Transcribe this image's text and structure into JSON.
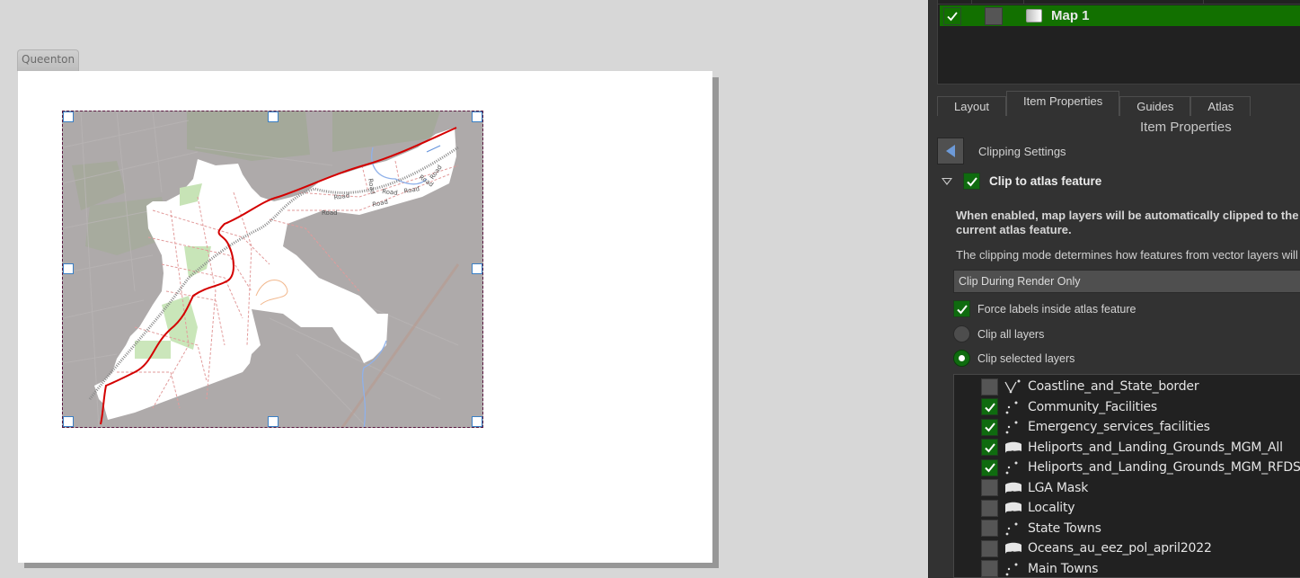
{
  "canvas": {
    "atlas_tab": "Queenton",
    "map_labels": [
      "Road",
      "Road",
      "Road",
      "Road",
      "Road",
      "Road",
      "Road",
      "Road"
    ]
  },
  "items_tree": {
    "rows": [
      {
        "visible": true,
        "locked": false,
        "name": "Map 1",
        "selected": true
      }
    ]
  },
  "tabs": [
    {
      "label": "Layout",
      "active": false
    },
    {
      "label": "Item Properties",
      "active": true
    },
    {
      "label": "Guides",
      "active": false
    },
    {
      "label": "Atlas",
      "active": false
    }
  ],
  "panel_title": "Item Properties",
  "section": {
    "back_label": "Clipping Settings",
    "clip_to_atlas": {
      "label": "Clip to atlas feature",
      "checked": true
    },
    "description": "When enabled, map layers will be automatically clipped to the\ncurrent atlas feature.",
    "mode_description": "The clipping mode determines how features from vector layers will be",
    "mode_select": {
      "value": "Clip During Render Only"
    },
    "force_labels": {
      "label": "Force labels inside atlas feature",
      "checked": true
    },
    "radio_options": [
      {
        "label": "Clip all layers",
        "selected": false
      },
      {
        "label": "Clip selected layers",
        "selected": true
      }
    ],
    "layers": [
      {
        "name": "Coastline_and_State_border",
        "checked": false,
        "type": "line"
      },
      {
        "name": "Community_Facilities",
        "checked": true,
        "type": "point"
      },
      {
        "name": "Emergency_services_facilities",
        "checked": true,
        "type": "point"
      },
      {
        "name": "Heliports_and_Landing_Grounds_MGM_All",
        "checked": true,
        "type": "polygon"
      },
      {
        "name": "Heliports_and_Landing_Grounds_MGM_RFDS_",
        "checked": true,
        "type": "point"
      },
      {
        "name": "LGA Mask",
        "checked": false,
        "type": "polygon"
      },
      {
        "name": "Locality",
        "checked": false,
        "type": "polygon"
      },
      {
        "name": "State Towns",
        "checked": false,
        "type": "point"
      },
      {
        "name": "Oceans_au_eez_pol_april2022",
        "checked": false,
        "type": "polygon"
      },
      {
        "name": "Main Towns",
        "checked": false,
        "type": "point"
      }
    ]
  },
  "colors": {
    "accent_green": "#127000",
    "check_green": "#0f6b0f",
    "route_red": "#d40000",
    "selection_blue": "#3a7fc4"
  }
}
